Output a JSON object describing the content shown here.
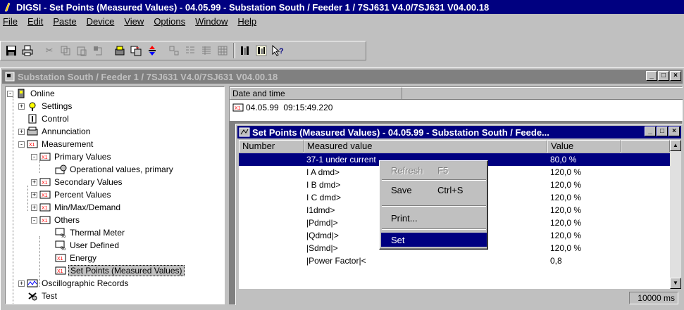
{
  "app": {
    "title": "DIGSI - Set Points (Measured Values) - 04.05.99 - Substation South / Feeder 1 / 7SJ631 V4.0/7SJ631 V04.00.18"
  },
  "menu": [
    "File",
    "Edit",
    "Paste",
    "Device",
    "View",
    "Options",
    "Window",
    "Help"
  ],
  "toolbar": {
    "icons": [
      "save-icon",
      "print-icon",
      "cut-icon",
      "copy-icon",
      "paste-icon",
      "undo-icon",
      "device-icon",
      "compare-icon",
      "transfer-icon",
      "small-icons-icon",
      "list-icon",
      "details-icon",
      "grid-icon",
      "plot-icon",
      "chart-icon",
      "help-pointer-icon"
    ]
  },
  "mdi": {
    "title": "Substation South / Feeder 1 / 7SJ631 V4.0/7SJ631 V04.00.18"
  },
  "tree": {
    "items": [
      {
        "label": "Online",
        "level": 0,
        "expander": "-"
      },
      {
        "label": "Settings",
        "level": 1,
        "expander": "+"
      },
      {
        "label": "Control",
        "level": 1,
        "expander": ""
      },
      {
        "label": "Annunciation",
        "level": 1,
        "expander": "+"
      },
      {
        "label": "Measurement",
        "level": 1,
        "expander": "-"
      },
      {
        "label": "Primary Values",
        "level": 2,
        "expander": "-"
      },
      {
        "label": "Operational values, primary",
        "level": 3,
        "expander": ""
      },
      {
        "label": "Secondary Values",
        "level": 2,
        "expander": "+"
      },
      {
        "label": "Percent Values",
        "level": 2,
        "expander": "+"
      },
      {
        "label": "Min/Max/Demand",
        "level": 2,
        "expander": "+"
      },
      {
        "label": "Others",
        "level": 2,
        "expander": "-"
      },
      {
        "label": "Thermal Meter",
        "level": 3,
        "expander": ""
      },
      {
        "label": "User Defined",
        "level": 3,
        "expander": ""
      },
      {
        "label": "Energy",
        "level": 3,
        "expander": ""
      },
      {
        "label": "Set Points (Measured Values)",
        "level": 3,
        "expander": "",
        "selected": true
      },
      {
        "label": "Oscillographic Records",
        "level": 1,
        "expander": "+"
      },
      {
        "label": "Test",
        "level": 1,
        "expander": ""
      }
    ]
  },
  "datetime": {
    "header": "Date and time",
    "value": "04.05.99  09:15:49.220"
  },
  "setpoints": {
    "title": "Set Points (Measured Values) - 04.05.99 - Substation South / Feede...",
    "columns": [
      "Number",
      "Measured value",
      "Value"
    ],
    "rows": [
      {
        "number": "",
        "measured": "37-1 under current",
        "value": "80,0 %"
      },
      {
        "number": "",
        "measured": "I A dmd>",
        "value": "120,0 %"
      },
      {
        "number": "",
        "measured": "I B dmd>",
        "value": "120,0 %"
      },
      {
        "number": "",
        "measured": "I C dmd>",
        "value": "120,0 %"
      },
      {
        "number": "",
        "measured": "I1dmd>",
        "value": "120,0 %"
      },
      {
        "number": "",
        "measured": "|Pdmd|>",
        "value": "120,0 %"
      },
      {
        "number": "",
        "measured": "|Qdmd|>",
        "value": "120,0 %"
      },
      {
        "number": "",
        "measured": "|Sdmd|>",
        "value": "120,0 %"
      },
      {
        "number": "",
        "measured": "|Power Factor|<",
        "value": "0,8"
      }
    ],
    "status": "10000 ms"
  },
  "context_menu": {
    "refresh": {
      "label": "Refresh",
      "accel": "F5"
    },
    "save": {
      "label": "Save",
      "accel": "Ctrl+S"
    },
    "print": {
      "label": "Print..."
    },
    "set": {
      "label": "Set"
    }
  },
  "colors": {
    "face": "#c0c0c0",
    "active_title": "#000080",
    "inactive_title": "#808080",
    "selection": "#000080"
  }
}
